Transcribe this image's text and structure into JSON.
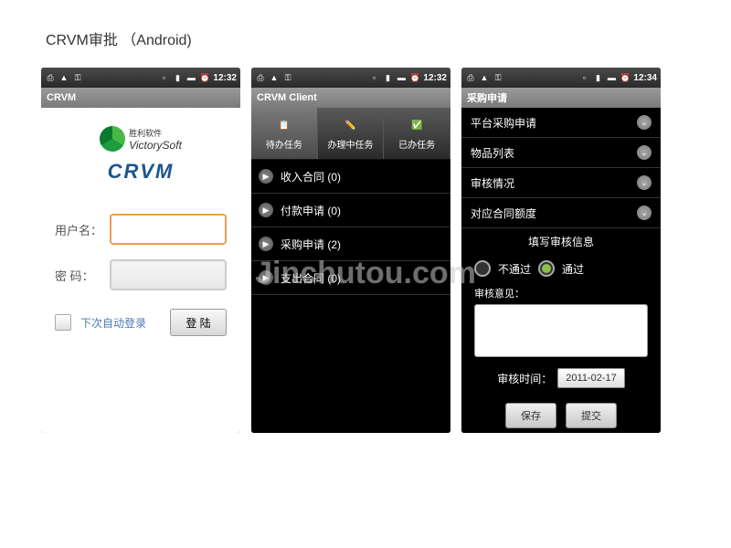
{
  "page_title": "CRVM审批 （Android)",
  "watermark": "Jinchutou.com",
  "status": {
    "times": [
      "12:32",
      "12:32",
      "12:34"
    ]
  },
  "screen1": {
    "titlebar": "CRVM",
    "logo_cn": "胜利软件",
    "logo_en": "VictorySoft",
    "logo_crvm": "CRVM",
    "user_label": "用户名：",
    "pass_label": "密  码：",
    "auto_login": "下次自动登录",
    "login_btn": "登 陆"
  },
  "screen2": {
    "titlebar": "CRVM Client",
    "tabs": [
      {
        "label": "待办任务",
        "active": true
      },
      {
        "label": "办理中任务",
        "active": false
      },
      {
        "label": "已办任务",
        "active": false
      }
    ],
    "items": [
      "收入合同 (0)",
      "付款申请 (0)",
      "采购申请 (2)",
      "支出合同 (0)"
    ]
  },
  "screen3": {
    "titlebar": "采购申请",
    "details": [
      "平台采购申请",
      "物品列表",
      "审核情况",
      "对应合同额度"
    ],
    "section_header": "填写审核信息",
    "radio_reject": "不通过",
    "radio_pass": "通过",
    "comment_label": "审核意见：",
    "date_label": "审核时间：",
    "date_value": "2011-02-17",
    "save_btn": "保存",
    "submit_btn": "提交"
  }
}
